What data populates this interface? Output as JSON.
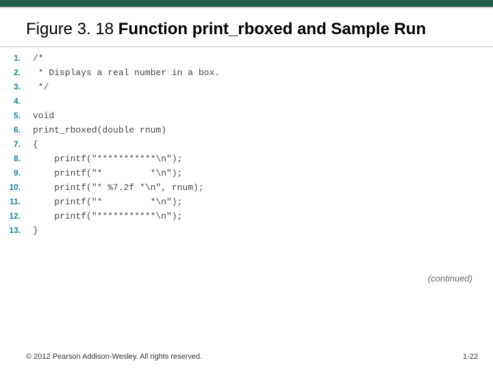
{
  "title": {
    "prefix": "Figure 3. 18 ",
    "main": "Function print_rboxed and Sample Run"
  },
  "code": {
    "lineNumbers": [
      "1.",
      "2.",
      "3.",
      "4.",
      "5.",
      "6.",
      "7.",
      "8.",
      "9.",
      "10.",
      "11.",
      "12.",
      "13."
    ],
    "lines": [
      "/*",
      " * Displays a real number in a box.",
      " */",
      "",
      "void",
      "print_rboxed(double rnum)",
      "{",
      "    printf(\"***********\\n\");",
      "    printf(\"*         *\\n\");",
      "    printf(\"* %7.2f *\\n\", rnum);",
      "    printf(\"*         *\\n\");",
      "    printf(\"***********\\n\");",
      "}"
    ]
  },
  "continued": "(continued)",
  "footer": "© 2012 Pearson Addison-Wesley. All rights reserved.",
  "pagenum": "1-22"
}
